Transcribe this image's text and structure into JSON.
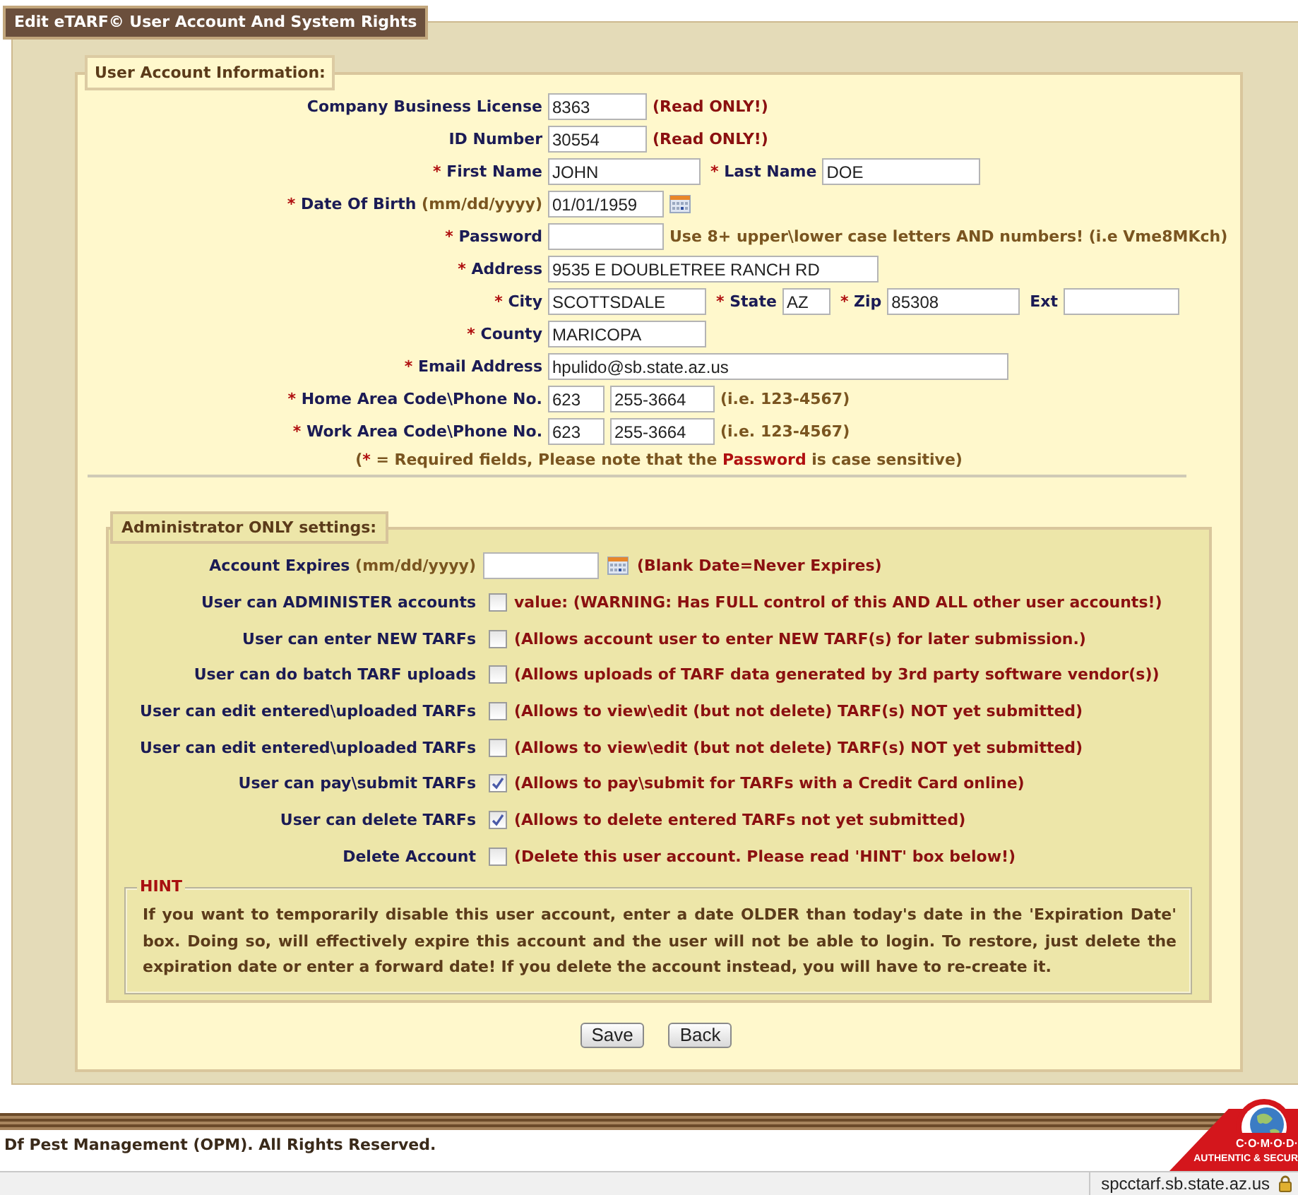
{
  "page_title": "Edit eTARF© User Account And System Rights",
  "user_account": {
    "legend": "User Account Information:",
    "rows": [
      {
        "items": [
          {
            "kind": "label",
            "text": "Company Business License"
          },
          {
            "kind": "input",
            "value": "8363"
          },
          {
            "kind": "warning",
            "text": "(Read ONLY!)"
          }
        ]
      },
      {
        "items": [
          {
            "kind": "label",
            "text": "ID Number"
          },
          {
            "kind": "input",
            "value": "30554"
          },
          {
            "kind": "warning",
            "text": "(Read ONLY!)"
          }
        ]
      },
      {
        "items": [
          {
            "kind": "label",
            "mark": "*",
            "text": "First Name"
          },
          {
            "kind": "input",
            "value": "JOHN"
          },
          {
            "kind": "label",
            "mark": "*",
            "text": "Last Name"
          },
          {
            "kind": "input",
            "value": "DOE"
          }
        ]
      },
      {
        "items": [
          {
            "kind": "label",
            "mark": "*",
            "text": "Date Of Birth",
            "format": "(mm/dd/yyyy)"
          },
          {
            "kind": "input",
            "value": "01/01/1959"
          },
          {
            "kind": "calendar"
          }
        ]
      },
      {
        "items": [
          {
            "kind": "label",
            "mark": "*",
            "text": "Password"
          },
          {
            "kind": "input"
          },
          {
            "kind": "hint",
            "text": "Use 8+ upper\\lower case letters AND numbers! (i.e Vme8MKch)"
          }
        ]
      },
      {
        "items": [
          {
            "kind": "label",
            "mark": "*",
            "text": "Address"
          },
          {
            "kind": "input",
            "value": "9535 E DOUBLETREE RANCH RD"
          }
        ]
      },
      {
        "items": [
          {
            "kind": "label",
            "mark": "*",
            "text": "City"
          },
          {
            "kind": "input",
            "value": "SCOTTSDALE"
          },
          {
            "kind": "label",
            "mark": "*",
            "text": "State"
          },
          {
            "kind": "input",
            "value": "AZ"
          },
          {
            "kind": "label",
            "mark": "*",
            "text": "Zip"
          },
          {
            "kind": "input",
            "value": "85308"
          },
          {
            "kind": "label",
            "text": "Ext"
          },
          {
            "kind": "input"
          }
        ]
      },
      {
        "items": [
          {
            "kind": "label",
            "mark": "*",
            "text": "County"
          },
          {
            "kind": "input",
            "value": "MARICOPA"
          }
        ]
      },
      {
        "items": [
          {
            "kind": "label",
            "mark": "*",
            "text": "Email Address"
          },
          {
            "kind": "input",
            "value": "hpulido@sb.state.az.us"
          }
        ]
      },
      {
        "items": [
          {
            "kind": "label",
            "mark": "*",
            "text": "Home Area Code\\Phone No."
          },
          {
            "kind": "input",
            "value": "623"
          },
          {
            "kind": "input",
            "value": "255-3664"
          },
          {
            "kind": "hint",
            "text": "(i.e. 123-4567)"
          }
        ]
      },
      {
        "items": [
          {
            "kind": "label",
            "mark": "*",
            "text": "Work Area Code\\Phone No."
          },
          {
            "kind": "input",
            "value": "623"
          },
          {
            "kind": "input",
            "value": "255-3664"
          },
          {
            "kind": "hint",
            "text": "(i.e. 123-4567)"
          }
        ]
      }
    ],
    "footnote": [
      {
        "text": "(",
        "highlight": false
      },
      {
        "text": "*",
        "highlight": true
      },
      {
        "text": " = Required fields, Please note that the ",
        "highlight": false
      },
      {
        "text": "Password",
        "highlight": true
      },
      {
        "text": " is case sensitive)",
        "highlight": false
      }
    ]
  },
  "admin": {
    "legend": "Administrator ONLY settings:",
    "expires": {
      "label": "Account Expires",
      "format": "(mm/dd/yyyy)",
      "note": "(Blank Date=Never Expires)"
    },
    "permissions": [
      {
        "label": "User can ADMINISTER accounts",
        "checked": false,
        "note": "value: (WARNING: Has FULL control of this AND ALL other user accounts!)"
      },
      {
        "label": "User can enter NEW TARFs",
        "checked": false,
        "note": "(Allows account user to enter NEW TARF(s) for later submission.)"
      },
      {
        "label": "User can do batch TARF uploads",
        "checked": false,
        "note": "(Allows uploads of TARF data generated by 3rd party software vendor(s))"
      },
      {
        "label": "User can edit entered\\uploaded TARFs",
        "checked": false,
        "note": "(Allows to view\\edit (but not delete) TARF(s) NOT yet submitted)"
      },
      {
        "label": "User can edit entered\\uploaded TARFs",
        "checked": false,
        "note": "(Allows to view\\edit (but not delete) TARF(s) NOT yet submitted)"
      },
      {
        "label": "User can pay\\submit TARFs",
        "checked": true,
        "note": "(Allows to pay\\submit for TARFs with a Credit Card online)"
      },
      {
        "label": "User can delete TARFs",
        "checked": true,
        "note": "(Allows to delete entered TARFs not yet submitted)"
      },
      {
        "label": "Delete Account",
        "checked": false,
        "note": "(Delete this user account. Please read 'HINT' box below!)"
      }
    ],
    "hint": {
      "legend": "HINT",
      "text": "If you want to temporarily disable this user account, enter a date OLDER than today's date in the 'Expiration Date' box. Doing so, will effectively expire this account and the user will not be able to login. To restore, just delete the expiration date or enter a forward date! If you delete the account instead, you will have to re-create it."
    }
  },
  "buttons": [
    "Save",
    "Back"
  ],
  "footer": {
    "copyright": "Df Pest Management (OPM). All Rights Reserved.",
    "badge": [
      "C·O·M·O·D·",
      "AUTHENTIC & SECUR"
    ]
  },
  "status_bar": {
    "url": "spcctarf.sb.state.az.us"
  }
}
